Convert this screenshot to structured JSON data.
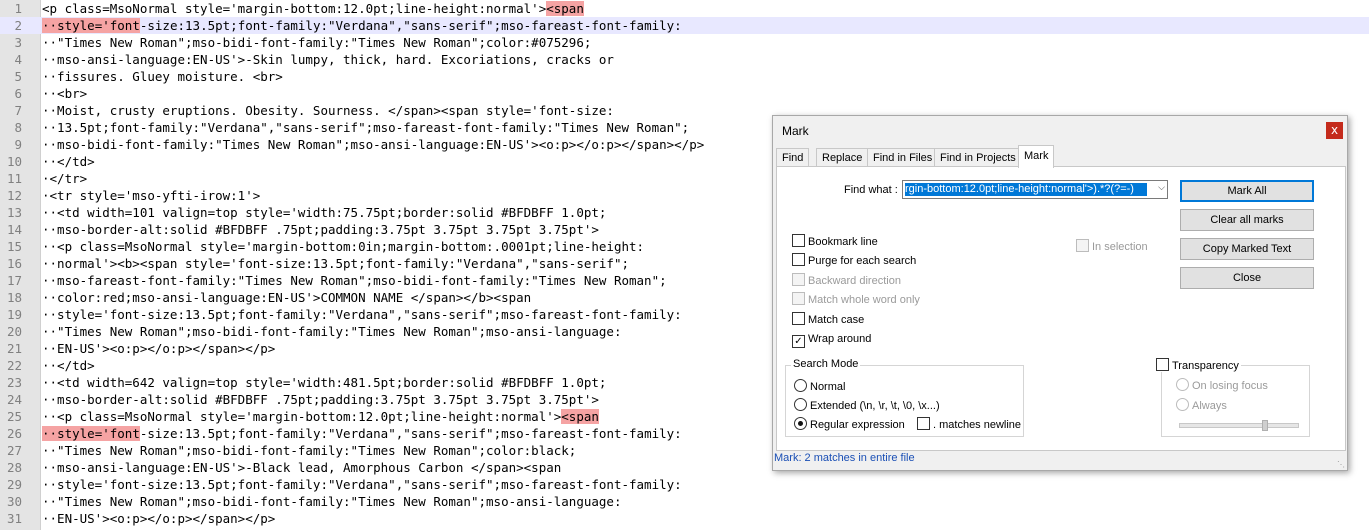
{
  "editor": {
    "lines": [
      {
        "n": "1",
        "parts": [
          {
            "t": "<p class=MsoNormal style='margin-bottom:12.0pt;line-height:normal'>"
          },
          {
            "t": "<span",
            "h": "hl"
          }
        ]
      },
      {
        "n": "2",
        "parts": [
          {
            "t": "··",
            "h": "hl"
          },
          {
            "t": "style='font",
            "h": "hl"
          },
          {
            "t": "-size:13.5pt;font-family:\"Verdana\",\"sans-serif\";mso-fareast-font-family:"
          }
        ]
      },
      {
        "n": "3",
        "parts": [
          {
            "t": "··\"Times New Roman\";mso-bidi-font-family:\"Times New Roman\";color:#075296;"
          }
        ]
      },
      {
        "n": "4",
        "parts": [
          {
            "t": "··mso-ansi-language:EN-US'>-Skin lumpy, thick, hard. Excoriations, cracks or"
          }
        ]
      },
      {
        "n": "5",
        "parts": [
          {
            "t": "··fissures. Gluey moisture. <br>"
          }
        ]
      },
      {
        "n": "6",
        "parts": [
          {
            "t": "··<br>"
          }
        ]
      },
      {
        "n": "7",
        "parts": [
          {
            "t": "··Moist, crusty eruptions. Obesity. Sourness. </span><span style='font-size:"
          }
        ]
      },
      {
        "n": "8",
        "parts": [
          {
            "t": "··13.5pt;font-family:\"Verdana\",\"sans-serif\";mso-fareast-font-family:\"Times New Roman\";"
          }
        ]
      },
      {
        "n": "9",
        "parts": [
          {
            "t": "··mso-bidi-font-family:\"Times New Roman\";mso-ansi-language:EN-US'><o:p></o:p></span></p>"
          }
        ]
      },
      {
        "n": "10",
        "parts": [
          {
            "t": "··</td>"
          }
        ]
      },
      {
        "n": "11",
        "parts": [
          {
            "t": "·</tr>"
          }
        ]
      },
      {
        "n": "12",
        "parts": [
          {
            "t": "·<tr style='mso-yfti-irow:1'>"
          }
        ]
      },
      {
        "n": "13",
        "parts": [
          {
            "t": "··<td width=101 valign=top style='width:75.75pt;border:solid #BFDBFF 1.0pt;"
          }
        ]
      },
      {
        "n": "14",
        "parts": [
          {
            "t": "··mso-border-alt:solid #BFDBFF .75pt;padding:3.75pt 3.75pt 3.75pt 3.75pt'>"
          }
        ]
      },
      {
        "n": "15",
        "parts": [
          {
            "t": "··<p class=MsoNormal style='margin-bottom:0in;margin-bottom:.0001pt;line-height:"
          }
        ]
      },
      {
        "n": "16",
        "parts": [
          {
            "t": "··normal'><b><span style='font-size:13.5pt;font-family:\"Verdana\",\"sans-serif\";"
          }
        ]
      },
      {
        "n": "17",
        "parts": [
          {
            "t": "··mso-fareast-font-family:\"Times New Roman\";mso-bidi-font-family:\"Times New Roman\";"
          }
        ]
      },
      {
        "n": "18",
        "parts": [
          {
            "t": "··color:red;mso-ansi-language:EN-US'>COMMON NAME </span></b><span"
          }
        ]
      },
      {
        "n": "19",
        "parts": [
          {
            "t": "··style='font-size:13.5pt;font-family:\"Verdana\",\"sans-serif\";mso-fareast-font-family:"
          }
        ]
      },
      {
        "n": "20",
        "parts": [
          {
            "t": "··\"Times New Roman\";mso-bidi-font-family:\"Times New Roman\";mso-ansi-language:"
          }
        ]
      },
      {
        "n": "21",
        "parts": [
          {
            "t": "··EN-US'><o:p></o:p></span></p>"
          }
        ]
      },
      {
        "n": "22",
        "parts": [
          {
            "t": "··</td>"
          }
        ]
      },
      {
        "n": "23",
        "parts": [
          {
            "t": "··<td width=642 valign=top style='width:481.5pt;border:solid #BFDBFF 1.0pt;"
          }
        ]
      },
      {
        "n": "24",
        "parts": [
          {
            "t": "··mso-border-alt:solid #BFDBFF .75pt;padding:3.75pt 3.75pt 3.75pt 3.75pt'>"
          }
        ]
      },
      {
        "n": "25",
        "parts": [
          {
            "t": "··<p class=MsoNormal style='margin-bottom:12.0pt;line-height:normal'>"
          },
          {
            "t": "<span",
            "h": "hl"
          }
        ]
      },
      {
        "n": "26",
        "parts": [
          {
            "t": "··",
            "h": "hl"
          },
          {
            "t": "style='font",
            "h": "hl"
          },
          {
            "t": "-size:13.5pt;font-family:\"Verdana\",\"sans-serif\";mso-fareast-font-family:"
          }
        ]
      },
      {
        "n": "27",
        "parts": [
          {
            "t": "··\"Times New Roman\";mso-bidi-font-family:\"Times New Roman\";color:black;"
          }
        ]
      },
      {
        "n": "28",
        "parts": [
          {
            "t": "··mso-ansi-language:EN-US'>-Black lead, Amorphous Carbon </span><span"
          }
        ]
      },
      {
        "n": "29",
        "parts": [
          {
            "t": "··style='font-size:13.5pt;font-family:\"Verdana\",\"sans-serif\";mso-fareast-font-family:"
          }
        ]
      },
      {
        "n": "30",
        "parts": [
          {
            "t": "··\"Times New Roman\";mso-bidi-font-family:\"Times New Roman\";mso-ansi-language:"
          }
        ]
      },
      {
        "n": "31",
        "parts": [
          {
            "t": "··EN-US'><o:p></o:p></span></p>"
          }
        ]
      }
    ],
    "current_line": "2",
    "highlight_color": "#f5a3a3"
  },
  "dialog": {
    "title": "Mark",
    "close_glyph": "x",
    "tabs": [
      "Find",
      "Replace",
      "Find in Files",
      "Find in Projects",
      "Mark"
    ],
    "active_tab": "Mark",
    "find_label": "Find what :",
    "find_value": "rgin-bottom:12.0pt;line-height:normal'>).*?(?=-)",
    "buttons": {
      "mark_all": "Mark All",
      "clear_all": "Clear all marks",
      "copy_marked": "Copy Marked Text",
      "close": "Close"
    },
    "options": {
      "bookmark_line": {
        "label": "Bookmark line",
        "checked": false
      },
      "purge": {
        "label": "Purge for each search",
        "checked": false
      },
      "backward": {
        "label": "Backward direction",
        "checked": false
      },
      "whole_word": {
        "label": "Match whole word only",
        "checked": false
      },
      "match_case": {
        "label": "Match case",
        "checked": false
      },
      "wrap_around": {
        "label": "Wrap around",
        "checked": true
      },
      "in_selection": {
        "label": "In selection",
        "checked": false
      }
    },
    "search_mode": {
      "title": "Search Mode",
      "normal": "Normal",
      "extended": "Extended (\\n, \\r, \\t, \\0, \\x...)",
      "regex": "Regular expression",
      "matches_newline": ". matches newline",
      "selected": "regex"
    },
    "transparency": {
      "title": "Transparency",
      "on_losing_focus": "On losing focus",
      "always": "Always"
    },
    "status": "Mark: 2 matches in entire file",
    "accent": "#0078d7",
    "close_color": "#c42b1c",
    "status_color": "#1a4fb5"
  }
}
